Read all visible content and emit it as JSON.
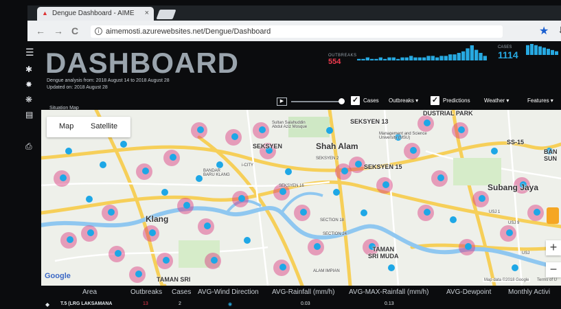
{
  "browser": {
    "tab_title": "Dengue Dashboard - AIME",
    "tab_close": "×",
    "url": "aimemosti.azurewebsites.net/Dengue/Dashboard",
    "back": "←",
    "forward": "→",
    "reload": "C"
  },
  "header": {
    "title": "DASHBOARD",
    "analysis_line": "Dengue analysis from: 2018 August 14 to 2018 August 28",
    "updated_line": "Updated on: 2018 August 28",
    "outbreaks_label": "OUTBREAKS",
    "outbreaks_value": "554",
    "cases_label": "CASES",
    "cases_value": "1114",
    "outbreaks_sparkline": [
      1,
      1,
      2,
      1,
      1,
      2,
      1,
      2,
      2,
      1,
      2,
      2,
      3,
      2,
      2,
      2,
      3,
      3,
      2,
      3,
      3,
      4,
      4,
      5,
      6,
      8,
      10,
      7,
      5,
      3
    ],
    "cases_sparkline": [
      8,
      9,
      8,
      7,
      6,
      5,
      4,
      3
    ]
  },
  "toolbar": {
    "panel_title": "Situation Map",
    "play_icon": "▶",
    "cases_label": "Cases",
    "cases_checked": true,
    "outbreaks_label": "Outbreaks ▾",
    "predictions_label": "Predictions",
    "predictions_checked": true,
    "weather_label": "Weather ▾",
    "features_label": "Features ▾"
  },
  "map": {
    "tab_map": "Map",
    "tab_satellite": "Satellite",
    "logo": "Google",
    "attribution": "Map data ©2018 Google",
    "terms": "Terms of U",
    "zoom_in": "+",
    "zoom_out": "−",
    "places": {
      "seksyen13": "SEKSYEN 13",
      "industrial_park": "DUSTRIAL PARK",
      "mosque": "Sultan Salahuddin\nAbdul Aziz Mosque",
      "msu": "Management and Science\nUniversity (MSU)",
      "seksyen": "SEKSYEN",
      "shah_alam": "Shah Alam",
      "ss15": "SS-15",
      "ban_sun": "BAN\nSUN",
      "seksyen2": "SEKSYEN 2",
      "seksyen15": "SEKSYEN 15",
      "icity": "i-CITY",
      "bandar_klang": "BANDAR\nBARU KLANG",
      "seksyen16": "SEKSYEN 16",
      "subang_jaya": "Subang Jaya",
      "usj1": "USJ 1",
      "usj9": "USJ 9",
      "usj": "USJ",
      "klang": "Klang",
      "section18": "SECTION 18",
      "section24": "SECTION 24",
      "taman_sri_muda": "TAMAN\nSRI MUDA",
      "taman_sri": "TAMAN SRI",
      "alam_impian": "ALAM IMPIAN"
    }
  },
  "table": {
    "headers": [
      "Area",
      "Outbreaks",
      "Cases",
      "AVG-Wind Direction",
      "AVG-Rainfall (mm/h)",
      "AVG-MAX-Rainfall (mm/h)",
      "AVG-Dewpoint",
      "Monthly Activi"
    ],
    "row": {
      "area": "T.5 (LRG LAKSAMANA",
      "outbreaks": "13",
      "cases": "2",
      "rainfall": "0.03",
      "max_rainfall": "0.13"
    }
  },
  "colors": {
    "accent_red": "#f23b4f",
    "accent_blue": "#27a9e1",
    "case_dot": "#1ea7e6",
    "outbreak_halo": "#d9357f"
  },
  "icons": [
    "hamburger-icon",
    "mosquito-icon",
    "virus-icon",
    "bug-icon",
    "weather-icon",
    "print-icon",
    "info-icon",
    "star-icon",
    "download-icon",
    "wind-direction-icon"
  ]
}
